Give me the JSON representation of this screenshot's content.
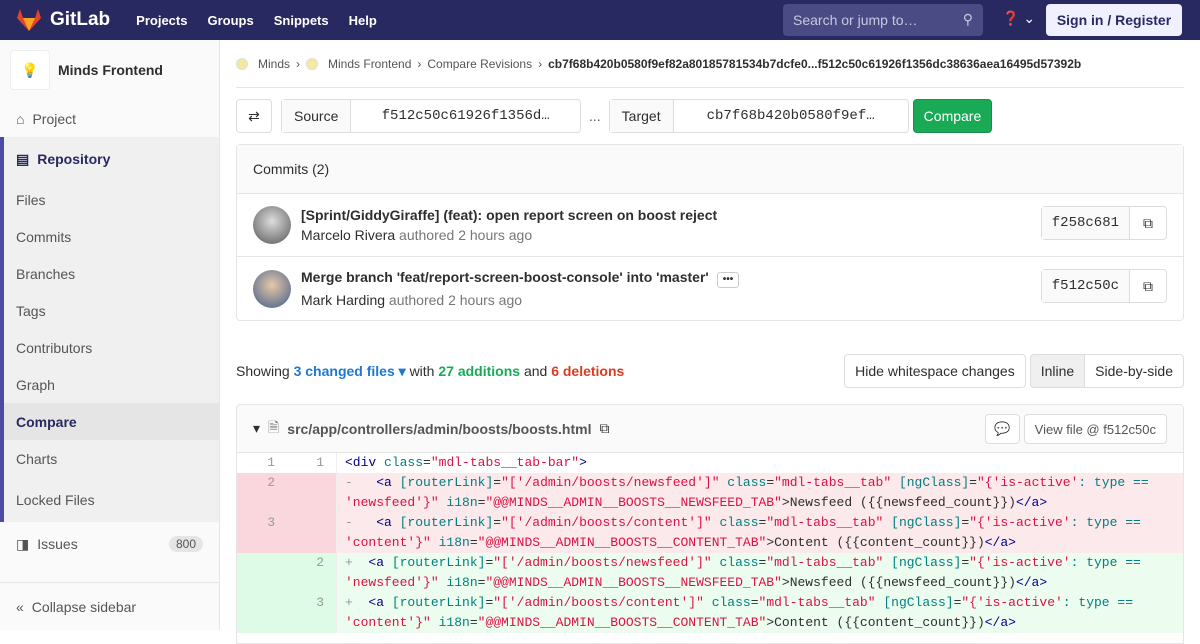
{
  "header": {
    "brand": "GitLab",
    "nav": [
      "Projects",
      "Groups",
      "Snippets",
      "Help"
    ],
    "search_placeholder": "Search or jump to…",
    "sign_in": "Sign in / Register"
  },
  "sidebar": {
    "project": "Minds Frontend",
    "project_item": "Project",
    "repository": "Repository",
    "items": [
      "Files",
      "Commits",
      "Branches",
      "Tags",
      "Contributors",
      "Graph",
      "Compare",
      "Charts",
      "Locked Files"
    ],
    "issues": "Issues",
    "issues_count": "800",
    "collapse": "Collapse sidebar"
  },
  "breadcrumb": [
    "Minds",
    "Minds Frontend",
    "Compare Revisions",
    "cb7f68b420b0580f9ef82a80185781534b7dcfe0...f512c50c61926f1356dc38636aea16495d57392b"
  ],
  "compare": {
    "source_label": "Source",
    "source": "f512c50c61926f1356d…",
    "sep": "...",
    "target_label": "Target",
    "target": "cb7f68b420b0580f9ef…",
    "button": "Compare"
  },
  "commits": {
    "title": "Commits (2)",
    "list": [
      {
        "title": "[Sprint/GiddyGiraffe] (feat): open report screen on boost reject",
        "author": "Marcelo Rivera",
        "meta": "authored 2 hours ago",
        "sha": "f258c681"
      },
      {
        "title": "Merge branch 'feat/report-screen-boost-console' into 'master'",
        "author": "Mark Harding",
        "meta": "authored 2 hours ago",
        "sha": "f512c50c"
      }
    ]
  },
  "stats": {
    "showing": "Showing",
    "changed": "3 changed files",
    "with": "with",
    "additions": "27 additions",
    "and": "and",
    "deletions": "6 deletions",
    "hide_ws": "Hide whitespace changes",
    "inline": "Inline",
    "side": "Side-by-side"
  },
  "file": {
    "path": "src/app/controllers/admin/boosts/boosts.html",
    "view": "View file @ f512c50c",
    "lines": [
      {
        "type": "ctx",
        "old": "1",
        "new": "1",
        "tokens": [
          [
            "t",
            "<div "
          ],
          [
            "a",
            "class"
          ],
          [
            "p",
            "="
          ],
          [
            "s",
            "\"mdl-tabs__tab-bar\""
          ],
          [
            "t",
            ">"
          ]
        ]
      },
      {
        "type": "old",
        "old": "2",
        "new": "",
        "tokens": [
          [
            "m",
            "-   "
          ],
          [
            "t",
            "<a "
          ],
          [
            "a",
            "[routerLink]"
          ],
          [
            "p",
            "="
          ],
          [
            "s",
            "\"['/admin/boosts/newsfeed']\""
          ],
          [
            "a",
            " class"
          ],
          [
            "p",
            "="
          ],
          [
            "s",
            "\"mdl-tabs__tab\""
          ],
          [
            "a",
            " [ngClass]"
          ],
          [
            "p",
            "="
          ],
          [
            "s",
            "\"{'is-active'"
          ],
          [
            "a",
            ": type == "
          ],
          [
            "s",
            "'newsfeed'}\""
          ],
          [
            "a",
            " i18n"
          ],
          [
            "p",
            "="
          ],
          [
            "s",
            "\"@@MINDS__ADMIN__BOOSTS__NEWSFEED_TAB\""
          ],
          [
            "p",
            ">Newsfeed ({{newsfeed_count}})"
          ],
          [
            "t",
            "</a>"
          ]
        ]
      },
      {
        "type": "old",
        "old": "3",
        "new": "",
        "tokens": [
          [
            "m",
            "-   "
          ],
          [
            "t",
            "<a "
          ],
          [
            "a",
            "[routerLink]"
          ],
          [
            "p",
            "="
          ],
          [
            "s",
            "\"['/admin/boosts/content']\""
          ],
          [
            "a",
            " class"
          ],
          [
            "p",
            "="
          ],
          [
            "s",
            "\"mdl-tabs__tab\""
          ],
          [
            "a",
            " [ngClass]"
          ],
          [
            "p",
            "="
          ],
          [
            "s",
            "\"{'is-active'"
          ],
          [
            "a",
            ": type == "
          ],
          [
            "s",
            "'content'}\""
          ],
          [
            "a",
            " i18n"
          ],
          [
            "p",
            "="
          ],
          [
            "s",
            "\"@@MINDS__ADMIN__BOOSTS__CONTENT_TAB\""
          ],
          [
            "p",
            ">Content ({{content_count}})"
          ],
          [
            "t",
            "</a>"
          ]
        ]
      },
      {
        "type": "new",
        "old": "",
        "new": "2",
        "tokens": [
          [
            "m",
            "+  "
          ],
          [
            "t",
            "<a "
          ],
          [
            "a",
            "[routerLink]"
          ],
          [
            "p",
            "="
          ],
          [
            "s",
            "\"['/admin/boosts/newsfeed']\""
          ],
          [
            "a",
            " class"
          ],
          [
            "p",
            "="
          ],
          [
            "s",
            "\"mdl-tabs__tab\""
          ],
          [
            "a",
            " [ngClass]"
          ],
          [
            "p",
            "="
          ],
          [
            "s",
            "\"{'is-active'"
          ],
          [
            "a",
            ": type == "
          ],
          [
            "s",
            "'newsfeed'}\""
          ],
          [
            "a",
            " i18n"
          ],
          [
            "p",
            "="
          ],
          [
            "s",
            "\"@@MINDS__ADMIN__BOOSTS__NEWSFEED_TAB\""
          ],
          [
            "p",
            ">Newsfeed ({{newsfeed_count}})"
          ],
          [
            "t",
            "</a>"
          ]
        ]
      },
      {
        "type": "new",
        "old": "",
        "new": "3",
        "tokens": [
          [
            "m",
            "+  "
          ],
          [
            "t",
            "<a "
          ],
          [
            "a",
            "[routerLink]"
          ],
          [
            "p",
            "="
          ],
          [
            "s",
            "\"['/admin/boosts/content']\""
          ],
          [
            "a",
            " class"
          ],
          [
            "p",
            "="
          ],
          [
            "s",
            "\"mdl-tabs__tab\""
          ],
          [
            "a",
            " [ngClass]"
          ],
          [
            "p",
            "="
          ],
          [
            "s",
            "\"{'is-active'"
          ],
          [
            "a",
            ": type == "
          ],
          [
            "s",
            "'content'}\""
          ],
          [
            "a",
            " i18n"
          ],
          [
            "p",
            "="
          ],
          [
            "s",
            "\"@@MINDS__ADMIN__BOOSTS__CONTENT_TAB\""
          ],
          [
            "p",
            ">Content ({{content_count}})"
          ],
          [
            "t",
            "</a>"
          ]
        ]
      }
    ]
  }
}
